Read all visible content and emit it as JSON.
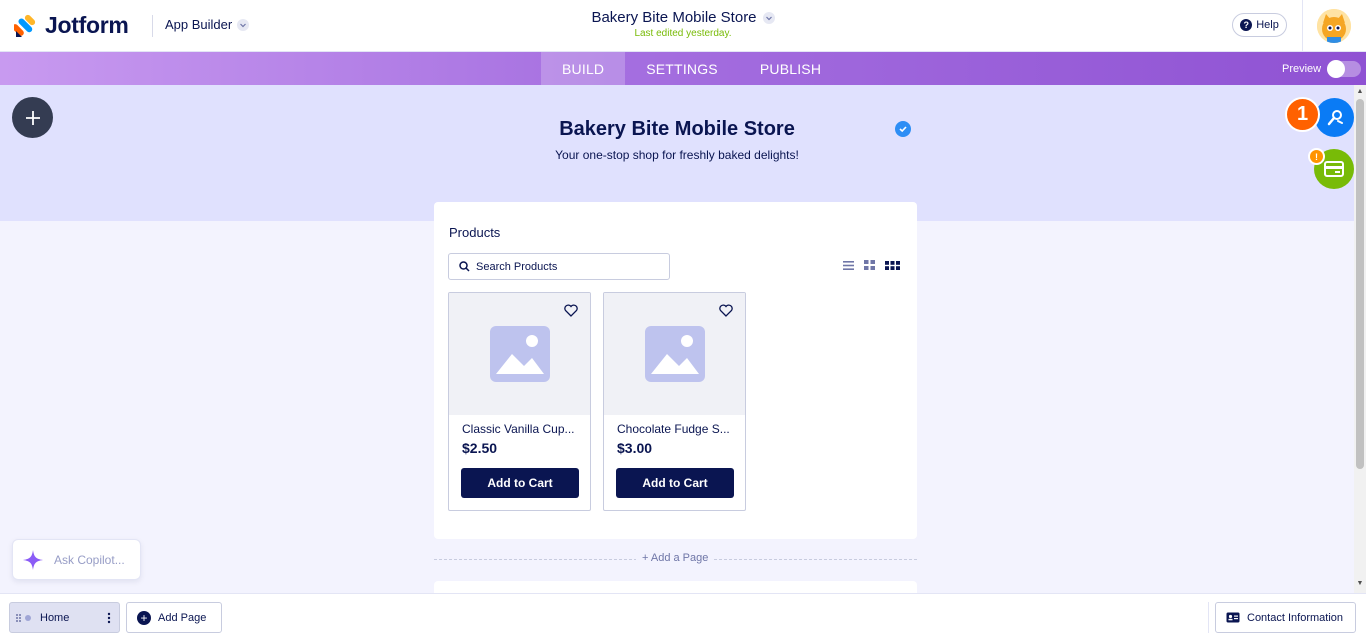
{
  "header": {
    "brand": "Jotform",
    "app_builder_label": "App Builder",
    "app_title": "Bakery Bite Mobile Store",
    "last_edited": "Last edited yesterday.",
    "help_label": "Help"
  },
  "tabs": [
    {
      "label": "BUILD",
      "active": true
    },
    {
      "label": "SETTINGS",
      "active": false
    },
    {
      "label": "PUBLISH",
      "active": false
    }
  ],
  "preview": {
    "label": "Preview",
    "enabled": false
  },
  "hero": {
    "title": "Bakery Bite Mobile Store",
    "subtitle": "Your one-stop shop for freshly baked delights!"
  },
  "floating": {
    "step_badge": "1",
    "alert_badge": "!"
  },
  "products_widget": {
    "title": "Products",
    "search_placeholder": "Search Products",
    "items": [
      {
        "name": "Classic Vanilla Cup...",
        "price": "$2.50",
        "button": "Add to Cart"
      },
      {
        "name": "Chocolate Fudge S...",
        "price": "$3.00",
        "button": "Add to Cart"
      }
    ]
  },
  "add_page_link": "+ Add a Page",
  "copilot_placeholder": "Ask Copilot...",
  "bottom": {
    "home_label": "Home",
    "add_page_label": "Add Page",
    "contact_label": "Contact Information"
  },
  "colors": {
    "navy": "#0a1551",
    "hero_bg": "#e0e1fe",
    "page_bg": "#f3f3fe",
    "accent_green": "#78bb07",
    "accent_orange": "#ff6100",
    "accent_blue": "#0a7bf5"
  }
}
